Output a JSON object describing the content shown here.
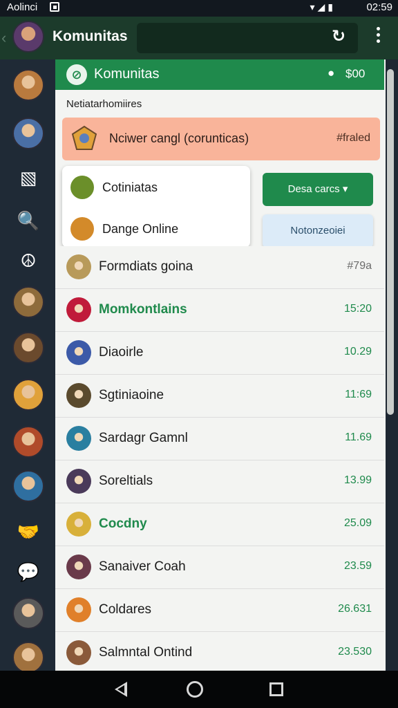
{
  "status_bar": {
    "carrier": "Aolinci",
    "time": "02:59"
  },
  "app_bar": {
    "title": "Komunitas",
    "refresh_icon": "refresh-icon",
    "more_icon": "more-vert-icon"
  },
  "sidebar": {
    "items": [
      {
        "icon": "hero-avatar-1",
        "color": "#b97a3e"
      },
      {
        "icon": "hero-avatar-2",
        "color": "#4a6fa5"
      },
      {
        "icon": "image-icon",
        "glyph": "▧"
      },
      {
        "icon": "search-icon",
        "glyph": "🔍"
      },
      {
        "icon": "peace-icon",
        "glyph": "☮"
      },
      {
        "icon": "hero-avatar-3",
        "color": "#8e6b3b"
      },
      {
        "icon": "hero-avatar-4",
        "color": "#6b4a2d"
      },
      {
        "icon": "hero-avatar-5",
        "color": "#e0a13a"
      },
      {
        "icon": "hero-avatar-6",
        "color": "#b04b2a"
      },
      {
        "icon": "hero-avatar-7",
        "color": "#2f6fa0"
      },
      {
        "icon": "handshake-icon",
        "glyph": "🤝"
      },
      {
        "icon": "chat-bubble-icon",
        "glyph": "💬"
      },
      {
        "icon": "hero-avatar-8",
        "color": "#5a5a5a"
      },
      {
        "icon": "hero-avatar-9",
        "color": "#a0713e"
      }
    ]
  },
  "panel": {
    "title": "Komunitas",
    "stat": "$00",
    "subheading": "Netiatarhomiires",
    "banner": {
      "text": "Nciwer cangl (corunticas)",
      "status": "#fraled"
    },
    "card": {
      "items": [
        {
          "label": "Cotiniatas",
          "color": "#6b8f2a"
        },
        {
          "label": "Dange Online",
          "color": "#d38a2a"
        }
      ]
    },
    "dropdown_button": "Desa carcs",
    "secondary_button": "Notonzeoiei",
    "list": [
      {
        "name": "Formdiats goina",
        "value": "#79a",
        "color": "#b89a5a"
      },
      {
        "name": "Momkontlains",
        "value": "15:20",
        "color": "#c01b3a"
      },
      {
        "name": "Diaoirle",
        "value": "10.29",
        "color": "#3c5aa8"
      },
      {
        "name": "Sgtiniaoine",
        "value": "11:69",
        "color": "#5a4a2d"
      },
      {
        "name": "Sardagr Gamnl",
        "value": "11.69",
        "color": "#2a7fa0"
      },
      {
        "name": "Soreltials",
        "value": "13.99",
        "color": "#4a3a5a"
      },
      {
        "name": "Cocdny",
        "value": "25.09",
        "color": "#d8b03a"
      },
      {
        "name": "Sanaiver Coah",
        "value": "23.59",
        "color": "#6a3a4a"
      },
      {
        "name": "Coldares",
        "value": "26.631",
        "color": "#e0802a"
      },
      {
        "name": "Salmntal Ontind",
        "value": "23.530",
        "color": "#8a5a3a"
      }
    ]
  },
  "colors": {
    "accent": "#1f8a4c",
    "banner": "#f9b49a",
    "sidebar": "#1f2a36"
  }
}
